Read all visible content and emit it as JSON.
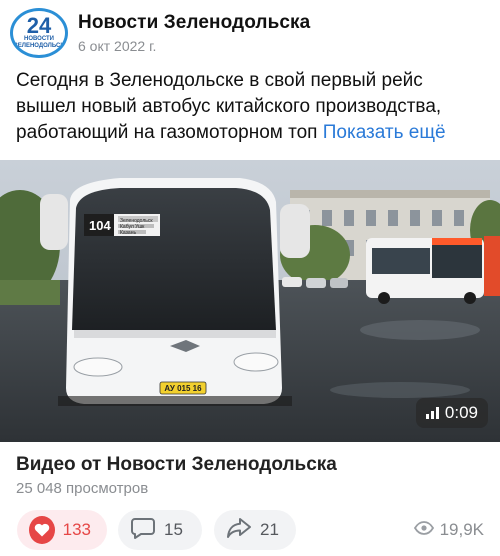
{
  "group": {
    "name": "Новости Зеленодольска",
    "avatar": {
      "number": "24",
      "caption_line1": "НОВОСТИ",
      "caption_line2": "ЗЕЛЕНОДОЛЬСК"
    },
    "date": "6 окт 2022 г."
  },
  "post": {
    "text_line1": "Сегодня в Зеленодольске в свой первый рейс",
    "text_line2": "вышел новый автобус китайского производства,",
    "text_line3": "работающий на газомоторном топ",
    "show_more": "Показать ещё"
  },
  "video": {
    "duration": "0:09",
    "bus_route_number": "104",
    "bus_route_text_1": "Зеленодольск",
    "bus_route_text_2": "Кабул Ушк",
    "bus_route_text_3": "Казань",
    "license_plate": "АУ 015 16",
    "title": "Видео от Новости Зеленодольска",
    "views": "25 048 просмотров"
  },
  "actions": {
    "likes": "133",
    "comments": "15",
    "shares": "21",
    "view_count": "19,9K"
  },
  "colors": {
    "accent": "#2a7ad8",
    "like_red": "#e64646",
    "pill_bg": "#f2f3f5",
    "muted": "#8a8d91"
  },
  "icons": [
    "heart-icon",
    "comment-icon",
    "share-icon",
    "eye-icon",
    "volume-bars-icon"
  ]
}
